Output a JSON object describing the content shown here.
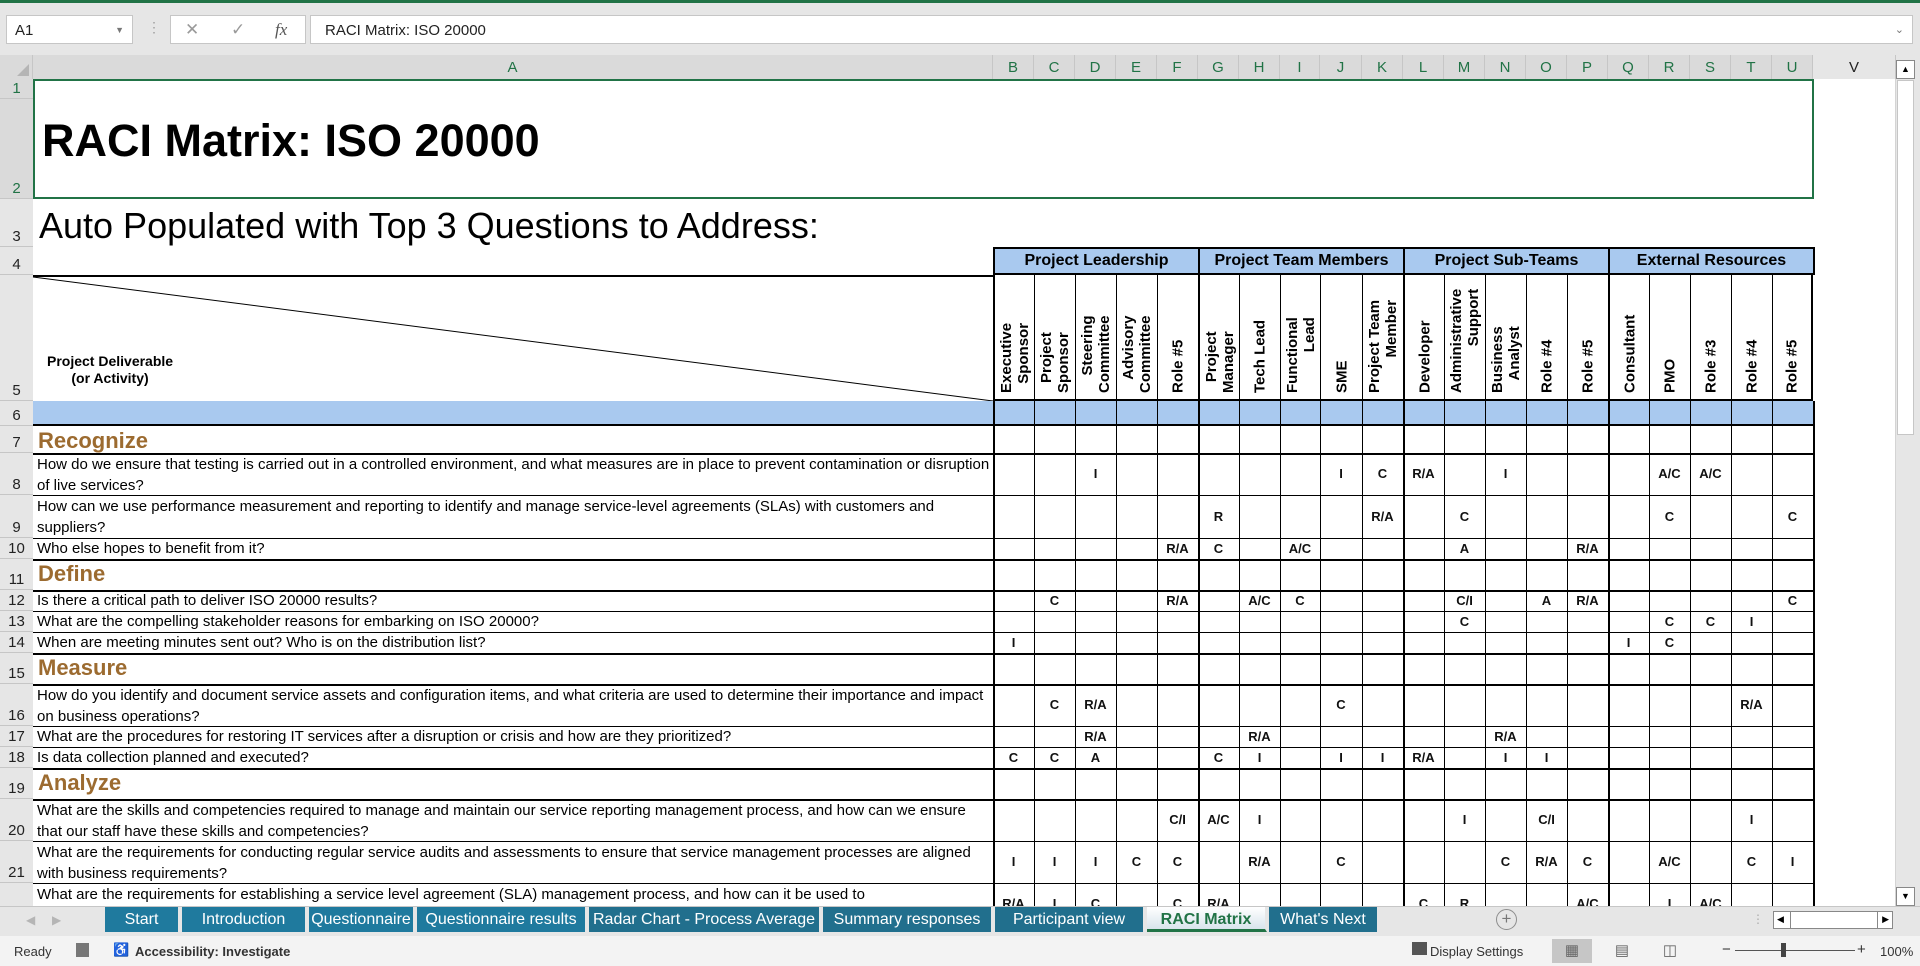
{
  "formula_bar": {
    "name_box": "A1",
    "formula": "RACI Matrix: ISO 20000",
    "cancel_icon": "x-icon",
    "enter_icon": "check-icon",
    "fx_label": "fx"
  },
  "columns": [
    "A",
    "B",
    "C",
    "D",
    "E",
    "F",
    "G",
    "H",
    "I",
    "J",
    "K",
    "L",
    "M",
    "N",
    "O",
    "P",
    "Q",
    "R",
    "S",
    "T",
    "U",
    "V"
  ],
  "sheet": {
    "title": "RACI Matrix: ISO 20000",
    "subtitle": "Auto Populated with Top 3 Questions to Address:",
    "deliverable_label_1": "Project Deliverable",
    "deliverable_label_2": "(or Activity)",
    "groups": [
      {
        "label": "Project Leadership",
        "span": 5
      },
      {
        "label": "Project Team Members",
        "span": 5
      },
      {
        "label": "Project Sub-Teams",
        "span": 5
      },
      {
        "label": "External Resources",
        "span": 5
      }
    ],
    "roles": [
      "Executive\nSponsor",
      "Project\nSponsor",
      "Steering\nCommittee",
      "Advisory\nCommittee",
      "Role #5",
      "Project\nManager",
      "Tech Lead",
      "Functional\nLead",
      "SME",
      "Project Team\nMember",
      "Developer",
      "Administrative\nSupport",
      "Business\nAnalyst",
      "Role #4",
      "Role #5",
      "Consultant",
      "PMO",
      "Role #3",
      "Role #4",
      "Role #5"
    ],
    "rows": [
      {
        "row": 7,
        "type": "section",
        "text": "Recognize"
      },
      {
        "row": 8,
        "type": "question",
        "text": "How do we ensure that testing is carried out in a controlled environment, and what measures are in place to prevent contamination or disruption of live services?",
        "raci": [
          "",
          "",
          "I",
          "",
          "",
          "",
          "",
          "",
          "I",
          "C",
          "R/A",
          "",
          "I",
          "",
          "",
          "",
          "A/C",
          "A/C",
          "",
          ""
        ]
      },
      {
        "row": 9,
        "type": "question",
        "text": "How can we use performance measurement and reporting to identify and manage service-level agreements (SLAs) with customers and suppliers?",
        "raci": [
          "",
          "",
          "",
          "",
          "",
          "R",
          "",
          "",
          "",
          "R/A",
          "",
          "C",
          "",
          "",
          "",
          "",
          "C",
          "",
          "",
          "C"
        ]
      },
      {
        "row": 10,
        "type": "question",
        "text": "Who else hopes to benefit from it?",
        "raci": [
          "",
          "",
          "",
          "",
          "R/A",
          "C",
          "",
          "A/C",
          "",
          "",
          "",
          "A",
          "",
          "",
          "R/A",
          "",
          "",
          "",
          "",
          ""
        ]
      },
      {
        "row": 11,
        "type": "section",
        "text": "Define"
      },
      {
        "row": 12,
        "type": "question",
        "text": "Is there a critical path to deliver ISO 20000 results?",
        "raci": [
          "",
          "C",
          "",
          "",
          "R/A",
          "",
          "A/C",
          "C",
          "",
          "",
          "",
          "C/I",
          "",
          "A",
          "R/A",
          "",
          "",
          "",
          "",
          "C"
        ]
      },
      {
        "row": 13,
        "type": "question",
        "text": "What are the compelling stakeholder reasons for embarking on ISO 20000?",
        "raci": [
          "",
          "",
          "",
          "",
          "",
          "",
          "",
          "",
          "",
          "",
          "",
          "C",
          "",
          "",
          "",
          "",
          "C",
          "C",
          "I",
          ""
        ]
      },
      {
        "row": 14,
        "type": "question",
        "text": "When are meeting minutes sent out? Who is on the distribution list?",
        "raci": [
          "I",
          "",
          "",
          "",
          "",
          "",
          "",
          "",
          "",
          "",
          "",
          "",
          "",
          "",
          "",
          "I",
          "C",
          "",
          "",
          ""
        ]
      },
      {
        "row": 15,
        "type": "section",
        "text": "Measure"
      },
      {
        "row": 16,
        "type": "question",
        "text": "How do you identify and document service assets and configuration items, and what criteria are used to determine their importance and impact on business operations?",
        "raci": [
          "",
          "C",
          "R/A",
          "",
          "",
          "",
          "",
          "",
          "C",
          "",
          "",
          "",
          "",
          "",
          "",
          "",
          "",
          "",
          "R/A",
          ""
        ]
      },
      {
        "row": 17,
        "type": "question",
        "text": "What are the procedures for restoring IT services after a disruption or crisis and how are they prioritized?",
        "raci": [
          "",
          "",
          "R/A",
          "",
          "",
          "",
          "R/A",
          "",
          "",
          "",
          "",
          "",
          "R/A",
          "",
          "",
          "",
          "",
          "",
          "",
          ""
        ]
      },
      {
        "row": 18,
        "type": "question",
        "text": "Is data collection planned and executed?",
        "raci": [
          "C",
          "C",
          "A",
          "",
          "",
          "C",
          "I",
          "",
          "I",
          "I",
          "R/A",
          "",
          "I",
          "I",
          "",
          "",
          "",
          "",
          "",
          ""
        ]
      },
      {
        "row": 19,
        "type": "section",
        "text": "Analyze"
      },
      {
        "row": 20,
        "type": "question",
        "text": "What are the skills and competencies required to manage and maintain our service reporting management process, and how can we ensure that our staff have these skills and competencies?",
        "raci": [
          "",
          "",
          "",
          "",
          "C/I",
          "A/C",
          "I",
          "",
          "",
          "",
          "",
          "I",
          "",
          "C/I",
          "",
          "",
          "",
          "",
          "I",
          ""
        ]
      },
      {
        "row": 21,
        "type": "question",
        "text": "What are the requirements for conducting regular service audits and assessments to ensure that service management processes are aligned with business requirements?",
        "raci": [
          "I",
          "I",
          "I",
          "C",
          "C",
          "",
          "R/A",
          "",
          "C",
          "",
          "",
          "",
          "C",
          "R/A",
          "C",
          "",
          "A/C",
          "",
          "C",
          "I"
        ]
      },
      {
        "row": 22,
        "type": "question",
        "text": "What are the requirements for establishing a service level agreement (SLA) management process, and how can it be used to",
        "raci": [
          "R/A",
          "I",
          "C",
          "",
          "C",
          "R/A",
          "",
          "",
          "",
          "",
          "C",
          "R",
          "",
          "",
          "A/C",
          "",
          "I",
          "A/C",
          "",
          ""
        ]
      }
    ]
  },
  "sheet_tabs": [
    {
      "label": "Start",
      "active": false
    },
    {
      "label": "Introduction",
      "active": false
    },
    {
      "label": "Questionnaire",
      "active": false
    },
    {
      "label": "Questionnaire results",
      "active": false
    },
    {
      "label": "Radar Chart - Process Average",
      "active": false
    },
    {
      "label": "Summary responses",
      "active": false
    },
    {
      "label": "Participant view",
      "active": false
    },
    {
      "label": "RACI Matrix",
      "active": true
    },
    {
      "label": "What's Next",
      "active": false
    }
  ],
  "status_bar": {
    "ready": "Ready",
    "accessibility": "Accessibility: Investigate",
    "display_settings": "Display Settings",
    "zoom": "100%",
    "zoom_level_percent": 100
  },
  "colors": {
    "excel_green": "#217346",
    "header_blue": "#a9c9ef",
    "section_brown": "#9c6b30",
    "tab_blue": "#1f7a9e"
  }
}
